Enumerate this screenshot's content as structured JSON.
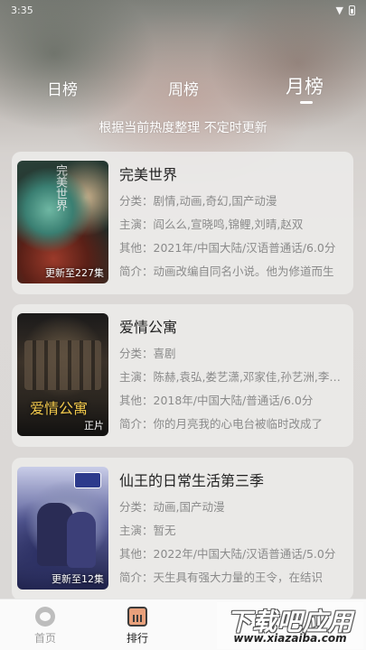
{
  "status_bar": {
    "time": "3:35",
    "wifi_icon": "wifi-icon",
    "battery_icon": "battery-icon"
  },
  "tabs": [
    {
      "label": "日榜",
      "active": false
    },
    {
      "label": "周榜",
      "active": false
    },
    {
      "label": "月榜",
      "active": true
    }
  ],
  "subtitle": "根据当前热度整理 不定时更新",
  "items": [
    {
      "title": "完美世界",
      "badge": "更新至227集",
      "poster_text": "完美世界",
      "category": "分类：剧情,动画,奇幻,国产动漫",
      "cast": "主演：阎么么,宣晓鸣,锦鲤,刘晴,赵双",
      "other": "其他：2021年/中国大陆/汉语普通话/6.0分",
      "summary": "简介：动画改编自同名小说。他为修道而生"
    },
    {
      "title": "爱情公寓",
      "badge": "正片",
      "poster_text": "爱情公寓",
      "category": "分类：喜剧",
      "cast": "主演：陈赫,袁弘,娄艺潇,邓家佳,孙艺洲,李金铭",
      "other": "其他：2018年/中国大陆/普通话/6.0分",
      "summary": "简介：你的月亮我的心电台被临时改成了"
    },
    {
      "title": "仙王的日常生活第三季",
      "badge": "更新至12集",
      "poster_text": "",
      "category": "分类：动画,国产动漫",
      "cast": "主演：暂无",
      "other": "其他：2022年/中国大陆/汉语普通话/5.0分",
      "summary": "简介：天生具有强大力量的王令，在结识"
    }
  ],
  "navbar": {
    "home_label": "首页",
    "rank_label": "排行",
    "active": "排行"
  },
  "watermark": {
    "main": "下载吧应用",
    "url": "www.xiazaiba.com"
  }
}
